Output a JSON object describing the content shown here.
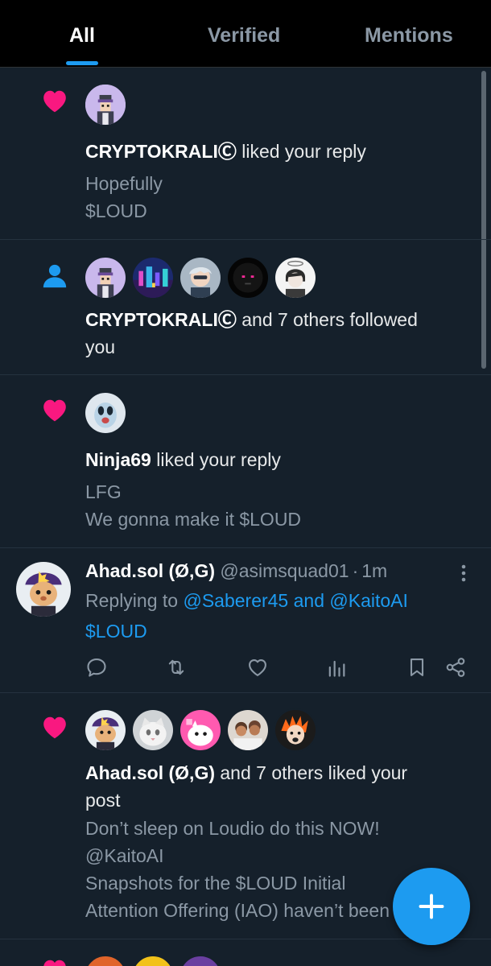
{
  "tabs": [
    {
      "label": "All",
      "active": true
    },
    {
      "label": "Verified",
      "active": false
    },
    {
      "label": "Mentions",
      "active": false
    }
  ],
  "notifications": [
    {
      "type": "like",
      "icon": "heart-icon",
      "user": "CRYPTOKRALIⒸ",
      "action": "liked your reply",
      "text_lines": [
        "Hopefully",
        "$LOUD"
      ]
    },
    {
      "type": "follow",
      "icon": "person-icon",
      "user": "CRYPTOKRALIⒸ",
      "action_lines": [
        "and 7 others followed",
        "you"
      ]
    },
    {
      "type": "like",
      "icon": "heart-icon",
      "user": "Ninja69",
      "action": "liked your reply",
      "text_lines": [
        "LFG",
        "We gonna make it $LOUD"
      ]
    },
    {
      "type": "reply",
      "name": "Ahad.sol (Ø,G)",
      "handle": "@asimsquad01",
      "separator": "·",
      "time": "1m",
      "replying_prefix": "Replying to",
      "replying_to": "@Saberer45 and @KaitoAI",
      "text": "$LOUD"
    },
    {
      "type": "like",
      "icon": "heart-icon",
      "user": "Ahad.sol (Ø,G)",
      "action_lines": [
        "and 7 others liked your",
        "post"
      ],
      "text_lines": [
        "Don’t sleep on Loudio  do this NOW!",
        "@KaitoAI",
        "Snapshots for the $LOUD Initial",
        "Attention Offering (IAO) haven’t been taken"
      ]
    }
  ],
  "colors": {
    "background": "#15202b",
    "tab_bar": "#000000",
    "accent": "#1d9bf0",
    "heart": "#f91880",
    "muted": "#8b98a5"
  },
  "fab": {
    "icon": "plus-icon"
  }
}
